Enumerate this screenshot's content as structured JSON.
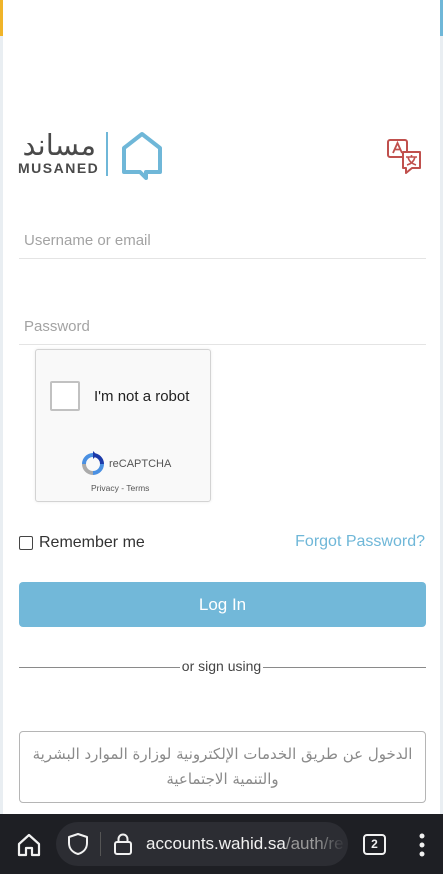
{
  "brand": {
    "name_ar": "مساند",
    "name_en": "MUSANED"
  },
  "form": {
    "username_placeholder": "Username or email",
    "username_value": "",
    "password_placeholder": "Password",
    "password_value": ""
  },
  "recaptcha": {
    "label": "I'm not a robot",
    "brand": "reCAPTCHA",
    "privacy": "Privacy",
    "separator": " - ",
    "terms": "Terms"
  },
  "options": {
    "remember_label": "Remember me",
    "forgot_label": "Forgot Password?"
  },
  "actions": {
    "login_label": "Log In",
    "or_text": "or sign using",
    "alt_login_label": "الدخول عن طريق الخدمات الإلكترونية لوزارة الموارد البشرية والتنمية الاجتماعية"
  },
  "browser": {
    "url_host": "accounts.wahid.sa",
    "url_path": "/auth/re",
    "tab_count": "2"
  },
  "colors": {
    "accent": "#72b8d9",
    "link": "#6fb7d8",
    "translate_icon": "#c0504d",
    "browser_bar": "#1e1f24"
  },
  "icons": [
    "musaned-logo-icon",
    "translate-icon",
    "recaptcha-logo-icon",
    "home-icon",
    "shield-icon",
    "lock-icon",
    "tabs-icon",
    "more-vertical-icon"
  ]
}
